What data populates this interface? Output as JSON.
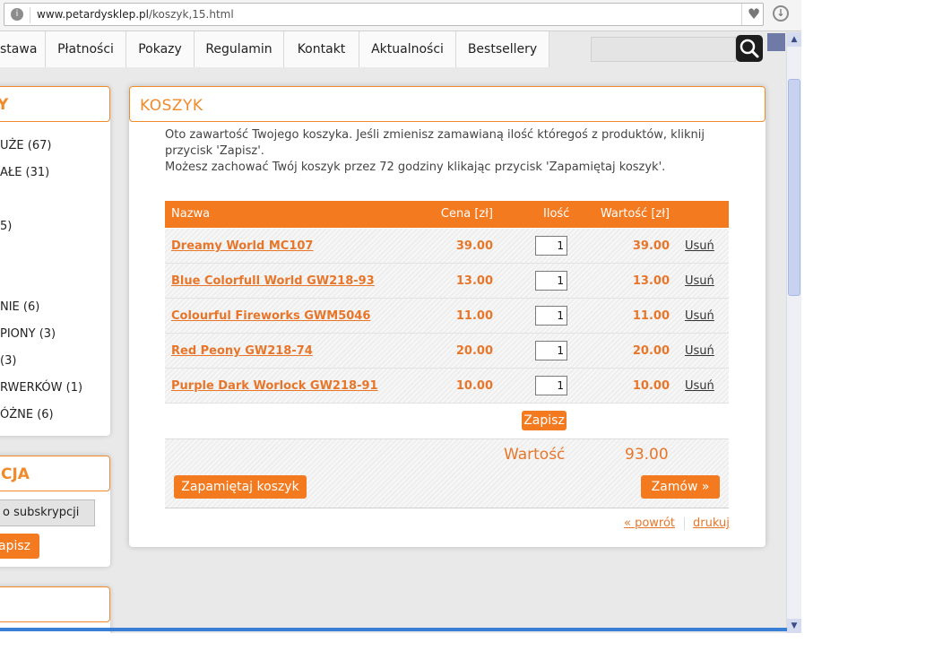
{
  "browser": {
    "url_domain": "www.petardysklep.pl",
    "url_path": "/koszyk,15.html"
  },
  "nav": {
    "items": [
      "stawa",
      "Płatności",
      "Pokazy",
      "Regulamin",
      "Kontakt",
      "Aktualności",
      "Bestsellery"
    ],
    "search_placeholder": ""
  },
  "sidebar": {
    "categories_header": "Y",
    "categories": [
      "UŻE (67)",
      "AŁE (31)",
      "5)",
      "NIE (6)",
      "PIONY (3)",
      "(3)",
      "RWERKÓW (1)",
      "ÓŻNE (6)"
    ],
    "newsletter_header": "CJA",
    "newsletter_input": "o subskrypcji",
    "newsletter_button": "apisz"
  },
  "cart": {
    "title": "KOSZYK",
    "intro_line1": "Oto zawartość Twojego koszyka. Jeśli zmienisz zamawianą ilość któregoś z produktów, kliknij",
    "intro_line2": "przycisk 'Zapisz'.",
    "intro_line3": "Możesz zachować Twój koszyk przez 72 godziny klikając przycisk 'Zapamiętaj koszyk'.",
    "columns": {
      "name": "Nazwa",
      "price": "Cena [zł]",
      "qty": "Ilość",
      "value": "Wartość [zł]"
    },
    "items": [
      {
        "name": "Dreamy World MC107",
        "price": "39.00",
        "qty": "1",
        "value": "39.00",
        "remove": "Usuń"
      },
      {
        "name": "Blue Colorfull World GW218-93",
        "price": "13.00",
        "qty": "1",
        "value": "13.00",
        "remove": "Usuń"
      },
      {
        "name": "Colourful Fireworks GWM5046",
        "price": "11.00",
        "qty": "1",
        "value": "11.00",
        "remove": "Usuń"
      },
      {
        "name": "Red Peony GW218-74",
        "price": "20.00",
        "qty": "1",
        "value": "20.00",
        "remove": "Usuń"
      },
      {
        "name": "Purple Dark Worlock GW218-91",
        "price": "10.00",
        "qty": "1",
        "value": "10.00",
        "remove": "Usuń"
      }
    ],
    "save_label": "Zapisz",
    "sum_label": "Wartość",
    "sum_value": "93.00",
    "remember_label": "Zapamiętaj koszyk",
    "order_label": "Zamów »",
    "back_label": "« powrót",
    "print_label": "drukuj"
  },
  "colors": {
    "accent": "#f47a20",
    "link": "#e8762a"
  }
}
